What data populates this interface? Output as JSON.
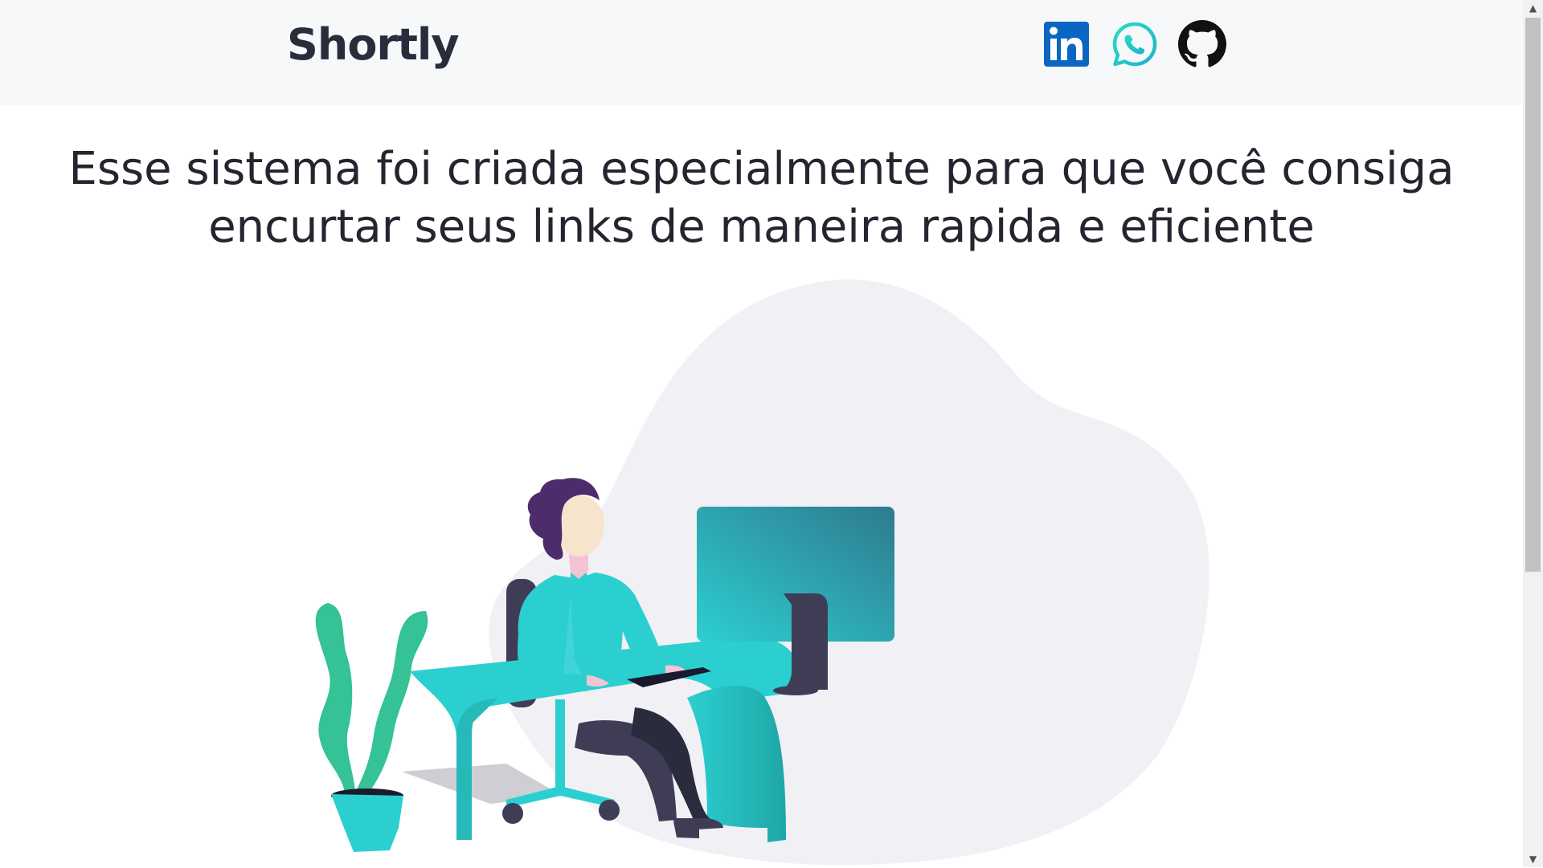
{
  "navbar": {
    "brand": "Shortly",
    "social": [
      {
        "name": "linkedin",
        "icon": "linkedin-icon",
        "color": "#0a66c2"
      },
      {
        "name": "whatsapp",
        "icon": "whatsapp-icon",
        "color": "#25d366"
      },
      {
        "name": "github",
        "icon": "github-icon",
        "color": "#111111"
      }
    ]
  },
  "hero": {
    "headline": "Esse sistema foi criada especialmente para que você consiga encurtar seus links de maneira rapida e eficiente"
  },
  "illustration": {
    "icon": "person-at-desk-illustration",
    "accent": "#2ccfd0",
    "blob": "#f0f0f5",
    "plant": "#34c296",
    "dark": "#3f3d56"
  },
  "scrollbar": {
    "up": "▲",
    "down": "▼"
  }
}
